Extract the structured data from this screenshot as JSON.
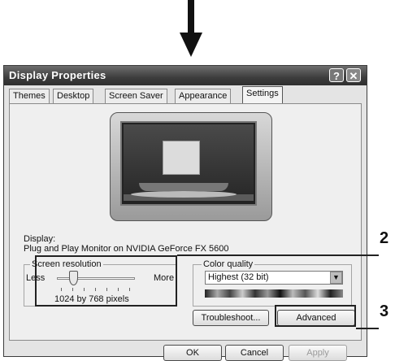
{
  "window": {
    "title": "Display Properties",
    "help_button": "?",
    "close_button": "✕"
  },
  "tabs": [
    {
      "label": "Themes"
    },
    {
      "label": "Desktop"
    },
    {
      "label": "Screen Saver"
    },
    {
      "label": "Appearance"
    },
    {
      "label": "Settings",
      "active": true
    }
  ],
  "display": {
    "label": "Display:",
    "value": "Plug and Play Monitor on NVIDIA GeForce FX 5600"
  },
  "screen_resolution": {
    "legend": "Screen resolution",
    "less_label": "Less",
    "more_label": "More",
    "value": "1024 by 768 pixels"
  },
  "color_quality": {
    "legend": "Color quality",
    "selected": "Highest (32 bit)"
  },
  "buttons": {
    "troubleshoot": "Troubleshoot...",
    "advanced": "Advanced",
    "ok": "OK",
    "cancel": "Cancel",
    "apply": "Apply"
  },
  "callouts": {
    "resolution": "2",
    "advanced": "3"
  },
  "icons": {
    "arrow": "arrow-down-icon",
    "dropdown": "chevron-down-icon"
  }
}
